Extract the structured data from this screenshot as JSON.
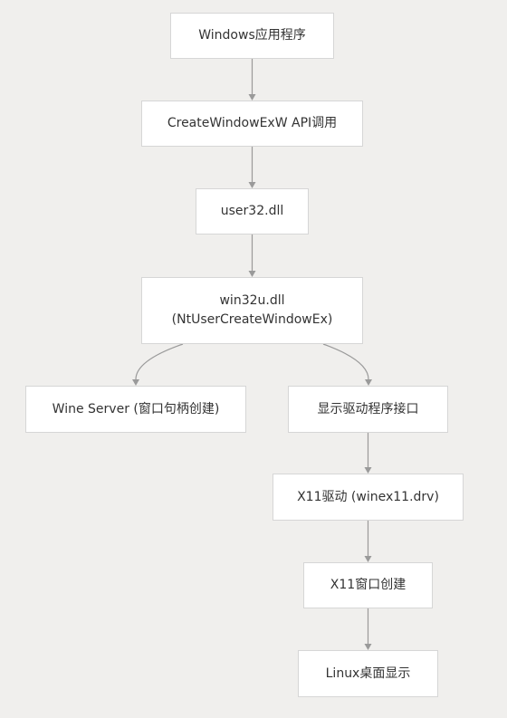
{
  "diagram": {
    "nodes": {
      "windows_app": "Windows应用程序",
      "create_window_api": "CreateWindowExW API调用",
      "user32": "user32.dll",
      "win32u_line1": "win32u.dll",
      "win32u_line2": "(NtUserCreateWindowEx)",
      "wine_server": "Wine Server (窗口句柄创建)",
      "display_driver_interface": "显示驱动程序接口",
      "x11_driver": "X11驱动 (winex11.drv)",
      "x11_window_create": "X11窗口创建",
      "linux_desktop": "Linux桌面显示"
    },
    "edges": [
      {
        "from": "windows_app",
        "to": "create_window_api"
      },
      {
        "from": "create_window_api",
        "to": "user32"
      },
      {
        "from": "user32",
        "to": "win32u"
      },
      {
        "from": "win32u",
        "to": "wine_server"
      },
      {
        "from": "win32u",
        "to": "display_driver_interface"
      },
      {
        "from": "display_driver_interface",
        "to": "x11_driver"
      },
      {
        "from": "x11_driver",
        "to": "x11_window_create"
      },
      {
        "from": "x11_window_create",
        "to": "linux_desktop"
      }
    ],
    "colors": {
      "background": "#f0efed",
      "node_fill": "#ffffff",
      "node_border": "#d6d6d6",
      "edge": "#9a9a9a",
      "text": "#333333"
    }
  }
}
